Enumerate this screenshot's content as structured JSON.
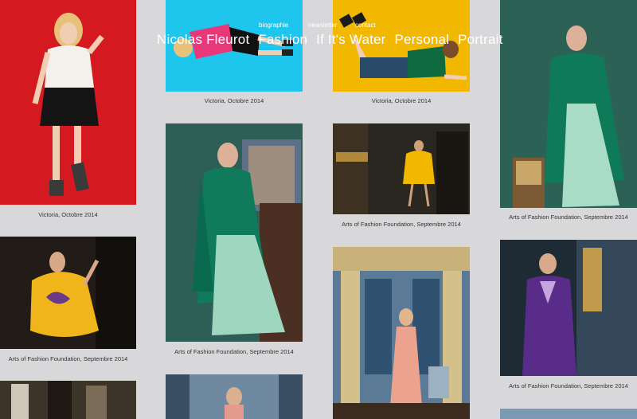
{
  "header": {
    "site_name": "Nicolas Fleurot",
    "small_links": [
      "biographie",
      "newsletter",
      "contact"
    ],
    "main_links": [
      "Fashion",
      "If It's Water",
      "Personal",
      "Portrait"
    ]
  },
  "gallery": {
    "col1": [
      {
        "subject": "woman-red-backdrop-icon",
        "caption": "Victoria, Octobre 2014"
      },
      {
        "subject": "woman-yellow-dress-icon",
        "caption": "Arts of Fashion Foundation, Septembre 2014"
      },
      {
        "subject": "interior-photo-icon",
        "caption": ""
      }
    ],
    "col2": [
      {
        "subject": "woman-lying-blue-icon",
        "caption": "Victoria, Octobre 2014"
      },
      {
        "subject": "woman-green-coat-icon",
        "caption": "Arts of Fashion Foundation, Septembre 2014"
      },
      {
        "subject": "interior-photo-icon",
        "caption": ""
      }
    ],
    "col3": [
      {
        "subject": "woman-lying-yellow-icon",
        "caption": "Victoria, Octobre 2014"
      },
      {
        "subject": "woman-dark-interior-icon",
        "caption": "Arts of Fashion Foundation, Septembre 2014"
      },
      {
        "subject": "woman-palace-pink-dress-icon",
        "caption": ""
      }
    ],
    "col4": [
      {
        "subject": "woman-green-coat-icon",
        "caption": "Arts of Fashion Foundation, Septembre 2014"
      },
      {
        "subject": "woman-purple-dress-icon",
        "caption": "Arts of Fashion Foundation, Septembre 2014"
      },
      {
        "subject": "photo-placeholder-icon",
        "caption": ""
      }
    ]
  },
  "colors": {
    "page_background": "#d8d8da",
    "nav_text": "#ffffff",
    "red_backdrop": "#d41920",
    "cyan_backdrop": "#1ec6ee",
    "yellow_backdrop": "#f2b800",
    "teal_backdrop": "#2e5f57",
    "dark_interior": "#2a2620"
  }
}
